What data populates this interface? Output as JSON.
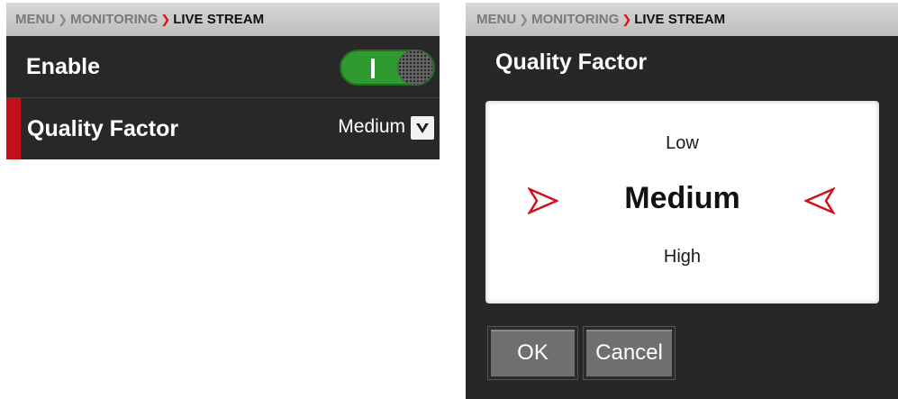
{
  "left": {
    "breadcrumb": {
      "item1": "MENU",
      "item2": "MONITORING",
      "current": "LIVE STREAM"
    },
    "enable": {
      "label": "Enable",
      "state": "on"
    },
    "quality": {
      "label": "Quality Factor",
      "value": "Medium"
    }
  },
  "right": {
    "breadcrumb": {
      "item1": "MENU",
      "item2": "MONITORING",
      "current": "LIVE STREAM"
    },
    "dialog_title": "Quality Factor",
    "options": [
      "Low",
      "Medium",
      "High"
    ],
    "selected": "Medium",
    "ok_label": "OK",
    "cancel_label": "Cancel"
  },
  "icons": {
    "separator": "chevron-right-icon",
    "dropdown": "chevron-down-icon",
    "picker_left": "arrow-right-outline-icon",
    "picker_right": "arrow-left-outline-icon"
  },
  "colors": {
    "accent_red": "#c4101a",
    "toggle_green": "#2f9a2f",
    "panel_bg": "#282828",
    "breadcrumb_bg": "#d0d0d0",
    "button_bg": "#6f6f6f"
  }
}
